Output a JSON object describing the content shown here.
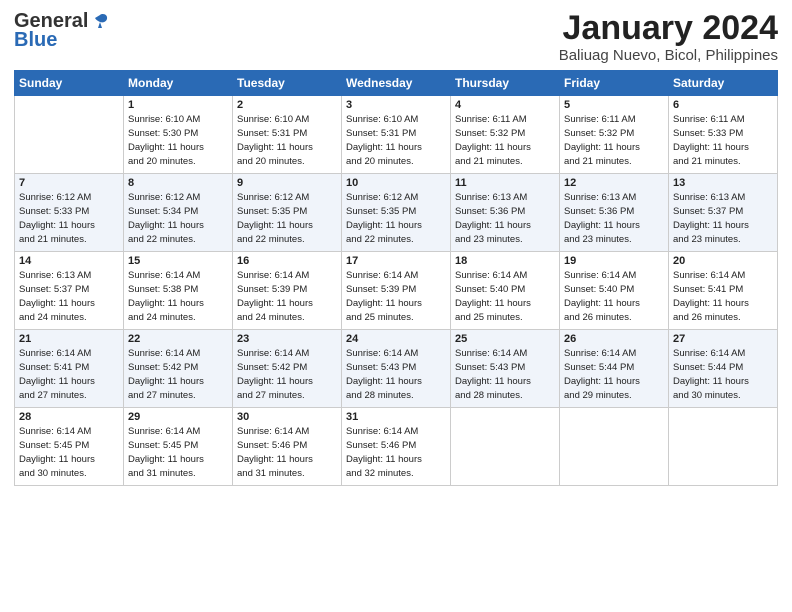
{
  "logo": {
    "general": "General",
    "blue": "Blue"
  },
  "header": {
    "title": "January 2024",
    "location": "Baliuag Nuevo, Bicol, Philippines"
  },
  "days_of_week": [
    "Sunday",
    "Monday",
    "Tuesday",
    "Wednesday",
    "Thursday",
    "Friday",
    "Saturday"
  ],
  "weeks": [
    [
      {
        "day": "",
        "info": ""
      },
      {
        "day": "1",
        "info": "Sunrise: 6:10 AM\nSunset: 5:30 PM\nDaylight: 11 hours\nand 20 minutes."
      },
      {
        "day": "2",
        "info": "Sunrise: 6:10 AM\nSunset: 5:31 PM\nDaylight: 11 hours\nand 20 minutes."
      },
      {
        "day": "3",
        "info": "Sunrise: 6:10 AM\nSunset: 5:31 PM\nDaylight: 11 hours\nand 20 minutes."
      },
      {
        "day": "4",
        "info": "Sunrise: 6:11 AM\nSunset: 5:32 PM\nDaylight: 11 hours\nand 21 minutes."
      },
      {
        "day": "5",
        "info": "Sunrise: 6:11 AM\nSunset: 5:32 PM\nDaylight: 11 hours\nand 21 minutes."
      },
      {
        "day": "6",
        "info": "Sunrise: 6:11 AM\nSunset: 5:33 PM\nDaylight: 11 hours\nand 21 minutes."
      }
    ],
    [
      {
        "day": "7",
        "info": "Sunrise: 6:12 AM\nSunset: 5:33 PM\nDaylight: 11 hours\nand 21 minutes."
      },
      {
        "day": "8",
        "info": "Sunrise: 6:12 AM\nSunset: 5:34 PM\nDaylight: 11 hours\nand 22 minutes."
      },
      {
        "day": "9",
        "info": "Sunrise: 6:12 AM\nSunset: 5:35 PM\nDaylight: 11 hours\nand 22 minutes."
      },
      {
        "day": "10",
        "info": "Sunrise: 6:12 AM\nSunset: 5:35 PM\nDaylight: 11 hours\nand 22 minutes."
      },
      {
        "day": "11",
        "info": "Sunrise: 6:13 AM\nSunset: 5:36 PM\nDaylight: 11 hours\nand 23 minutes."
      },
      {
        "day": "12",
        "info": "Sunrise: 6:13 AM\nSunset: 5:36 PM\nDaylight: 11 hours\nand 23 minutes."
      },
      {
        "day": "13",
        "info": "Sunrise: 6:13 AM\nSunset: 5:37 PM\nDaylight: 11 hours\nand 23 minutes."
      }
    ],
    [
      {
        "day": "14",
        "info": "Sunrise: 6:13 AM\nSunset: 5:37 PM\nDaylight: 11 hours\nand 24 minutes."
      },
      {
        "day": "15",
        "info": "Sunrise: 6:14 AM\nSunset: 5:38 PM\nDaylight: 11 hours\nand 24 minutes."
      },
      {
        "day": "16",
        "info": "Sunrise: 6:14 AM\nSunset: 5:39 PM\nDaylight: 11 hours\nand 24 minutes."
      },
      {
        "day": "17",
        "info": "Sunrise: 6:14 AM\nSunset: 5:39 PM\nDaylight: 11 hours\nand 25 minutes."
      },
      {
        "day": "18",
        "info": "Sunrise: 6:14 AM\nSunset: 5:40 PM\nDaylight: 11 hours\nand 25 minutes."
      },
      {
        "day": "19",
        "info": "Sunrise: 6:14 AM\nSunset: 5:40 PM\nDaylight: 11 hours\nand 26 minutes."
      },
      {
        "day": "20",
        "info": "Sunrise: 6:14 AM\nSunset: 5:41 PM\nDaylight: 11 hours\nand 26 minutes."
      }
    ],
    [
      {
        "day": "21",
        "info": "Sunrise: 6:14 AM\nSunset: 5:41 PM\nDaylight: 11 hours\nand 27 minutes."
      },
      {
        "day": "22",
        "info": "Sunrise: 6:14 AM\nSunset: 5:42 PM\nDaylight: 11 hours\nand 27 minutes."
      },
      {
        "day": "23",
        "info": "Sunrise: 6:14 AM\nSunset: 5:42 PM\nDaylight: 11 hours\nand 27 minutes."
      },
      {
        "day": "24",
        "info": "Sunrise: 6:14 AM\nSunset: 5:43 PM\nDaylight: 11 hours\nand 28 minutes."
      },
      {
        "day": "25",
        "info": "Sunrise: 6:14 AM\nSunset: 5:43 PM\nDaylight: 11 hours\nand 28 minutes."
      },
      {
        "day": "26",
        "info": "Sunrise: 6:14 AM\nSunset: 5:44 PM\nDaylight: 11 hours\nand 29 minutes."
      },
      {
        "day": "27",
        "info": "Sunrise: 6:14 AM\nSunset: 5:44 PM\nDaylight: 11 hours\nand 30 minutes."
      }
    ],
    [
      {
        "day": "28",
        "info": "Sunrise: 6:14 AM\nSunset: 5:45 PM\nDaylight: 11 hours\nand 30 minutes."
      },
      {
        "day": "29",
        "info": "Sunrise: 6:14 AM\nSunset: 5:45 PM\nDaylight: 11 hours\nand 31 minutes."
      },
      {
        "day": "30",
        "info": "Sunrise: 6:14 AM\nSunset: 5:46 PM\nDaylight: 11 hours\nand 31 minutes."
      },
      {
        "day": "31",
        "info": "Sunrise: 6:14 AM\nSunset: 5:46 PM\nDaylight: 11 hours\nand 32 minutes."
      },
      {
        "day": "",
        "info": ""
      },
      {
        "day": "",
        "info": ""
      },
      {
        "day": "",
        "info": ""
      }
    ]
  ]
}
